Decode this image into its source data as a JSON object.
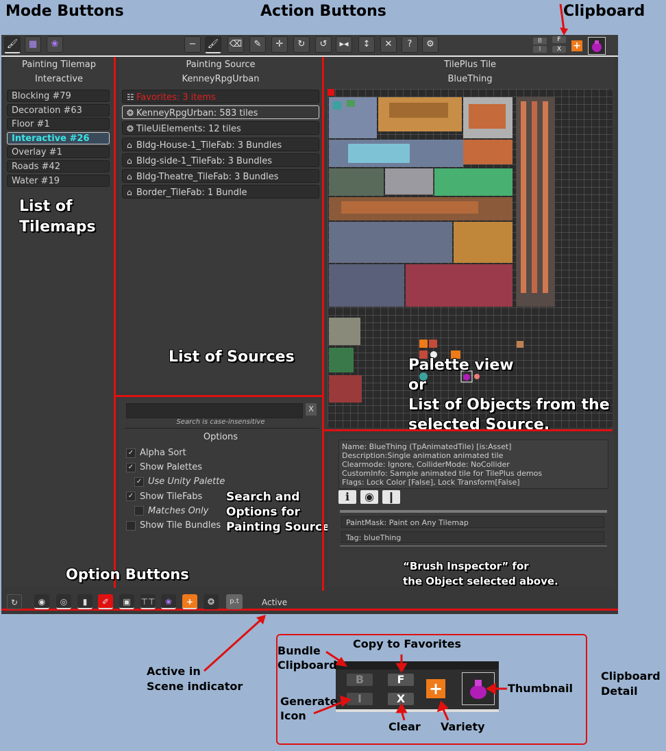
{
  "annotations": {
    "mode_buttons": "Mode Buttons",
    "action_buttons": "Action Buttons",
    "clipboard": "Clipboard",
    "list_of_tilemaps": "List of\nTilemaps",
    "list_of_sources": "List of Sources",
    "palette_view": "Palette view\nor\nList of Objects from the\nselected Source.",
    "search_options": "Search and\nOptions for\nPainting Source",
    "option_buttons": "Option Buttons",
    "brush_inspector": "“Brush Inspector” for\nthe Object selected above.",
    "active_indicator": "Active in\nScene indicator",
    "clipboard_detail": "Clipboard\nDetail",
    "bundle_clipboard": "Bundle\nClipboard",
    "copy_to_favorites": "Copy to Favorites",
    "generate_icon": "Generate\nIcon",
    "clear": "Clear",
    "variety": "Variety",
    "thumbnail": "Thumbnail"
  },
  "toolbar": {
    "mode_icons": [
      "brush-icon",
      "grid-icon",
      "palette-dots-icon"
    ],
    "action_icons": [
      "minus-icon",
      "brush-icon",
      "eraser-icon",
      "eyedropper-icon",
      "move-icon",
      "rotate-cw-icon",
      "rotate-ccw-icon",
      "flip-x-icon",
      "flip-y-icon",
      "close-icon",
      "help-icon",
      "gear-icon"
    ],
    "clip_b": "B",
    "clip_f": "F",
    "clip_i": "I",
    "clip_x": "X",
    "help_glyph": "?"
  },
  "tilemaps": {
    "title": "Painting Tilemap",
    "subtitle": "Interactive",
    "items": [
      "Blocking #79",
      "Decoration #63",
      "Floor #1",
      "Interactive #26",
      "Overlay #1",
      "Roads #42",
      "Water #19"
    ],
    "selected_index": 3
  },
  "sources": {
    "title": "Painting Source",
    "subtitle": "KenneyRpgUrban",
    "items": [
      {
        "label": "Favorites: 3 items",
        "icon": "clipboard-icon"
      },
      {
        "label": "KenneyRpgUrban: 583 tiles",
        "icon": "palette-icon"
      },
      {
        "label": "TileUiElements: 12 tiles",
        "icon": "palette-icon"
      },
      {
        "label": "Bldg-House-1_TileFab: 3 Bundles",
        "icon": "basket-icon"
      },
      {
        "label": "Bldg-side-1_TileFab: 3 Bundles",
        "icon": "basket-icon"
      },
      {
        "label": "Bldg-Theatre_TileFab: 3 Bundles",
        "icon": "basket-icon"
      },
      {
        "label": "Border_TileFab: 1 Bundle",
        "icon": "basket-icon"
      }
    ]
  },
  "search": {
    "placeholder": "",
    "hint": "Search is case-insensitive",
    "clear_label": "X"
  },
  "options": {
    "title": "Options",
    "items": [
      {
        "label": "Alpha Sort",
        "checked": true,
        "italic": false
      },
      {
        "label": "Show Palettes",
        "checked": true,
        "italic": false
      },
      {
        "label": "Use Unity Palette",
        "checked": true,
        "italic": true
      },
      {
        "label": "Show TileFabs",
        "checked": true,
        "italic": false
      },
      {
        "label": "Matches Only",
        "checked": false,
        "italic": true
      },
      {
        "label": "Show Tile Bundles",
        "checked": false,
        "italic": false
      }
    ]
  },
  "tile": {
    "title": "TilePlus Tile",
    "subtitle": "BlueThing"
  },
  "inspector": {
    "lines": [
      "Name: BlueThing (TpAnimatedTile) [is:Asset]",
      "Description:Single animation animated tile",
      "Clearmode: Ignore, ColliderMode: NoCollider",
      "CustomInfo: Sample animated tile for TilePlus demos",
      "Flags: Lock Color [False], Lock Transform[False]"
    ],
    "paintmask": "PaintMask: Paint on Any Tilemap",
    "tag": "Tag: blueThing"
  },
  "bottom": {
    "icons": [
      "refresh-icon",
      "eye-icon",
      "target-icon",
      "trash-icon",
      "paint-icon",
      "lock-icon",
      "text-icon",
      "palette-dots-icon",
      "plus-icon",
      "palette-icon",
      "pt-icon"
    ],
    "pt_label": "p.t",
    "active": "Active"
  },
  "colors": {
    "accent_red": "#e01010",
    "selected_text": "#39e6e6",
    "variety_orange": "#ef7a1a",
    "background": "#9db5d3"
  }
}
